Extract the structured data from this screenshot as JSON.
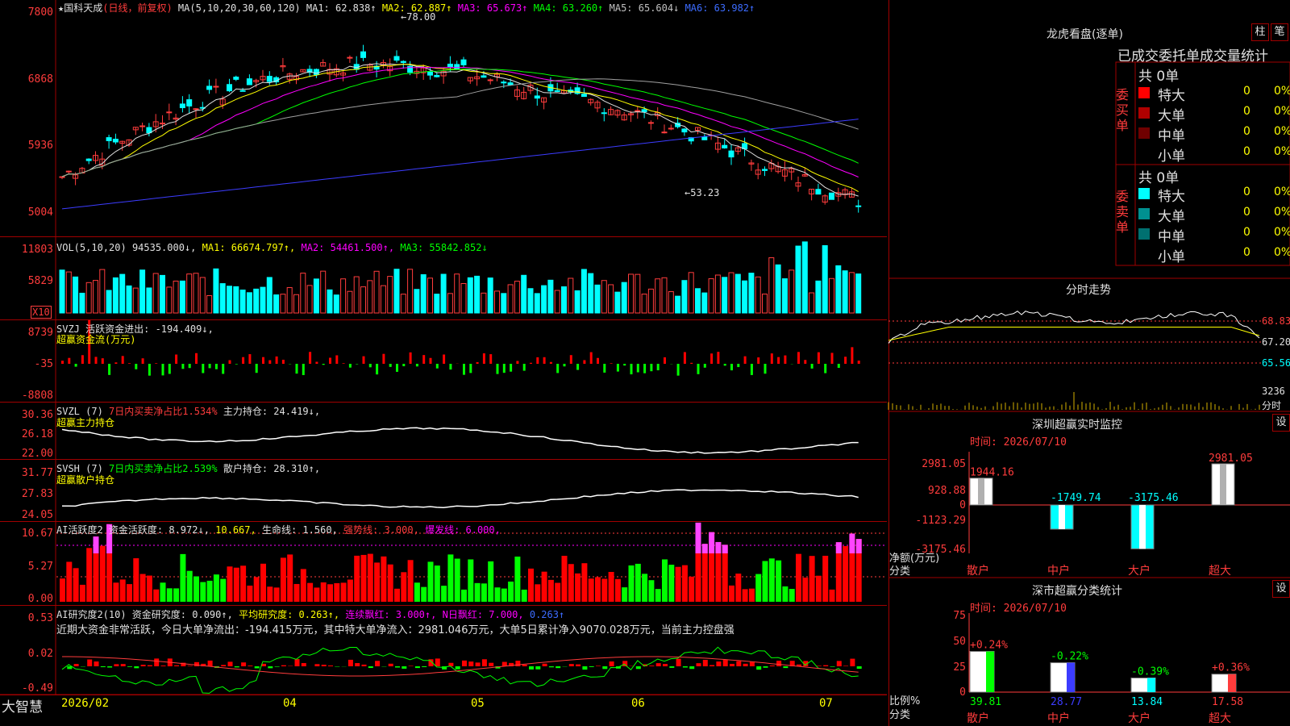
{
  "stock": {
    "name": "★国科天成",
    "period": "(日线，前复权)"
  },
  "ma_line": {
    "label": "MA(5,10,20,30,60,120)",
    "items": [
      {
        "text": "MA1: 62.838↑",
        "color": "#e0e0e0"
      },
      {
        "text": "MA2: 62.887↑",
        "color": "#ffff00"
      },
      {
        "text": "MA3: 65.673↑",
        "color": "#ff00ff"
      },
      {
        "text": "MA4: 63.260↑",
        "color": "#00ff00"
      },
      {
        "text": "MA5: 65.604↓",
        "color": "#c0c0c0"
      },
      {
        "text": "MA6: 63.982↑",
        "color": "#3c6cff"
      }
    ],
    "high_mark": "78.00",
    "low_mark": "53.23"
  },
  "main_axis": [
    "7800",
    "6868",
    "5936",
    "5004"
  ],
  "vol": {
    "label": "VOL(5,10,20)",
    "value": "94535.000↓,",
    "items": [
      {
        "text": "MA1: 66674.797↑,",
        "color": "#ffff00"
      },
      {
        "text": "MA2: 54461.500↑,",
        "color": "#ff00ff"
      },
      {
        "text": "MA3: 55842.852↓",
        "color": "#00ff00"
      }
    ],
    "axis": [
      "11803",
      "5829"
    ],
    "unit": "X10"
  },
  "svzj": {
    "label": "SVZJ  活跃资金进出: -194.409↓,",
    "sub": "超赢资金流(万元)",
    "axis": [
      "8739",
      "-35",
      "-8808"
    ]
  },
  "svzl": {
    "label": "SVZL (7)",
    "pct": "7日内买卖净占比1.534%",
    "hold": "主力持仓: 24.419↓,",
    "sub": "超赢主力持仓",
    "axis": [
      "30.36",
      "26.18",
      "22.00"
    ]
  },
  "svsh": {
    "label": "SVSH (7)",
    "pct": "7日内买卖净占比2.539%",
    "hold": "散户持仓: 28.310↑,",
    "sub": "超赢散户持仓",
    "axis": [
      "31.77",
      "27.83",
      "24.05"
    ]
  },
  "ai1": {
    "label": "AI活跃度2 资金活跃度: 8.972↓,",
    "v2": "10.667,",
    "life": "生命线: 1.560,",
    "strong": "强势线: 3.000,",
    "burst": "爆发线: 6.000,",
    "axis": [
      "10.67",
      "5.27",
      "0.00"
    ]
  },
  "ai2": {
    "label": "AI研究度2(10) 资金研究度: 0.090↑,",
    "avg": "平均研究度: 0.263↑,",
    "cont": "连续飘红: 3.000↑,",
    "nday": "N日飘红: 7.000,",
    "last": "0.263↑",
    "msg": "近期大资金非常活跃，今日大单净流出：-194.415万元，其中特大单净流入：2981.046万元，大单5日累计净入9070.028万元，当前主力控盘强",
    "axis": [
      "0.53",
      "0.02",
      "-0.49"
    ]
  },
  "bottom": {
    "brand": "大智慧",
    "dates": [
      "2026/02",
      "04",
      "05",
      "06",
      "07"
    ]
  },
  "lhb": {
    "title": "龙虎看盘(逐单)",
    "btn1": "柱",
    "btn2": "笔",
    "tabs": "已成交委托单成交量统计",
    "buy_label": "委买单",
    "sell_label": "委卖单",
    "buy_total": "共 0单",
    "sell_total": "共 0单",
    "buy_rows": [
      {
        "name": "特大",
        "v": "0",
        "p": "0%",
        "color": "#ff0000"
      },
      {
        "name": "大单",
        "v": "0",
        "p": "0%",
        "color": "#b00000"
      },
      {
        "name": "中单",
        "v": "0",
        "p": "0%",
        "color": "#700000"
      },
      {
        "name": "小单",
        "v": "0",
        "p": "0%",
        "color": ""
      }
    ],
    "sell_rows": [
      {
        "name": "特大",
        "v": "0",
        "p": "0%",
        "color": "#00ffff"
      },
      {
        "name": "大单",
        "v": "0",
        "p": "0%",
        "color": "#009090"
      },
      {
        "name": "中单",
        "v": "0",
        "p": "0%",
        "color": "#007070"
      },
      {
        "name": "小单",
        "v": "0",
        "p": "0%",
        "color": ""
      }
    ]
  },
  "fenshi": {
    "title": "分时走势",
    "axis": [
      "68.83",
      "67.20",
      "65.56"
    ],
    "vol_axis": "3236",
    "vol_unit": "分时"
  },
  "monitor": {
    "title": "深圳超赢实时监控",
    "btn": "设",
    "date": "时间: 2026/07/10",
    "axis": [
      "2981.05",
      "928.88",
      "0",
      "-1123.29",
      "-3175.46"
    ],
    "ylabel": "净额(万元)",
    "xlabel": "分类",
    "bars": [
      {
        "cat": "散户",
        "value": "1944.16",
        "v": 1944.16
      },
      {
        "cat": "中户",
        "value": "-1749.74",
        "v": -1749.74
      },
      {
        "cat": "大户",
        "value": "-3175.46",
        "v": -3175.46
      },
      {
        "cat": "超大",
        "value": "2981.05",
        "v": 2981.05
      }
    ]
  },
  "classify": {
    "title": "深市超赢分类统计",
    "btn": "设",
    "date": "时间: 2026/07/10",
    "axis": [
      "75",
      "50",
      "25",
      "0"
    ],
    "ylabel": "比例%",
    "xlabel": "分类",
    "bars": [
      {
        "cat": "散户",
        "value": "39.81",
        "change": "+0.24%",
        "v": 39.81,
        "color": "#00ff00"
      },
      {
        "cat": "中户",
        "value": "28.77",
        "change": "-0.22%",
        "v": 28.77,
        "color": "#3c3cff"
      },
      {
        "cat": "大户",
        "value": "13.84",
        "change": "-0.39%",
        "v": 13.84,
        "color": "#00ffff"
      },
      {
        "cat": "超大",
        "value": "17.58",
        "change": "+0.36%",
        "v": 17.58,
        "color": "#ff3c3c"
      }
    ]
  }
}
